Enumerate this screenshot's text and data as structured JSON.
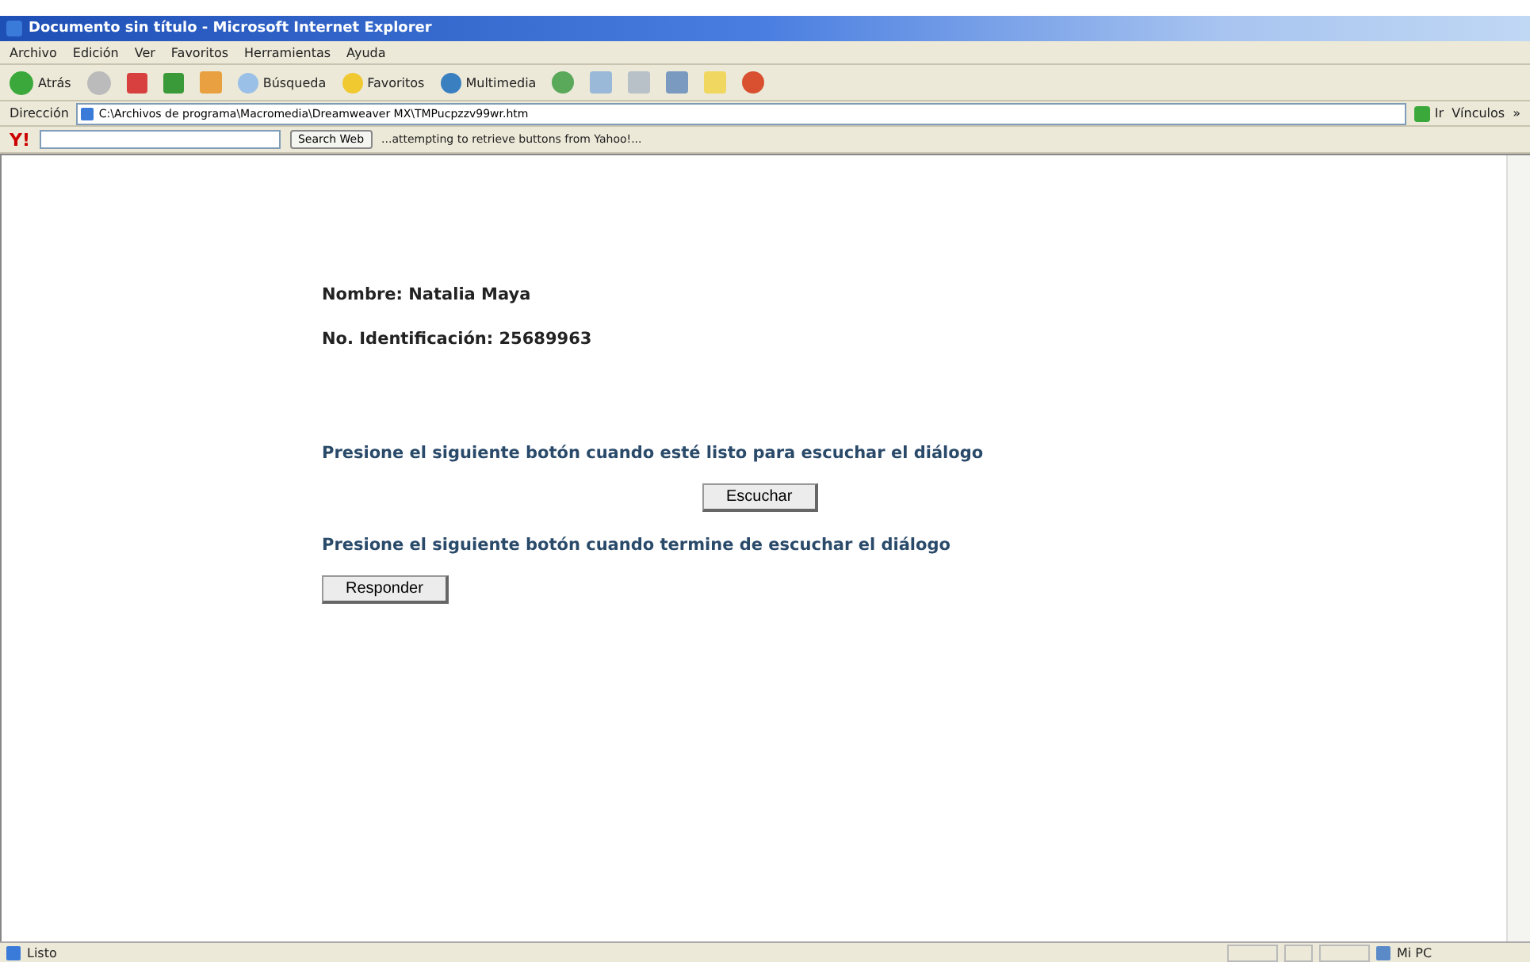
{
  "window": {
    "title": "Documento sin título - Microsoft Internet Explorer"
  },
  "menu": [
    "Archivo",
    "Edición",
    "Ver",
    "Favoritos",
    "Herramientas",
    "Ayuda"
  ],
  "toolbar": {
    "back": "Atrás",
    "search": "Búsqueda",
    "favorites": "Favoritos",
    "media": "Multimedia"
  },
  "address_bar": {
    "label": "Dirección",
    "value": "C:\\Archivos de programa\\Macromedia\\Dreamweaver MX\\TMPucpzzv99wr.htm",
    "go": "Ir",
    "links": "Vínculos",
    "more": "»"
  },
  "yahoo_bar": {
    "logo": "Y!",
    "search_button": "Search Web",
    "status": "...attempting to retrieve buttons from Yahoo!..."
  },
  "page": {
    "items": [
      {
        "kind": "info",
        "text": "Nombre: Natalia Maya"
      },
      {
        "kind": "info",
        "text": "No. Identificación: 25689963"
      },
      {
        "kind": "prompt",
        "text": "Presione el siguiente botón cuando esté listo para escuchar el diálogo"
      },
      {
        "kind": "button",
        "text": "Escuchar"
      },
      {
        "kind": "prompt",
        "text": "Presione el siguiente botón cuando termine de escuchar el diálogo"
      },
      {
        "kind": "button",
        "text": "Responder"
      }
    ]
  },
  "status_bar": {
    "status": "Listo",
    "zone": "Mi PC"
  }
}
